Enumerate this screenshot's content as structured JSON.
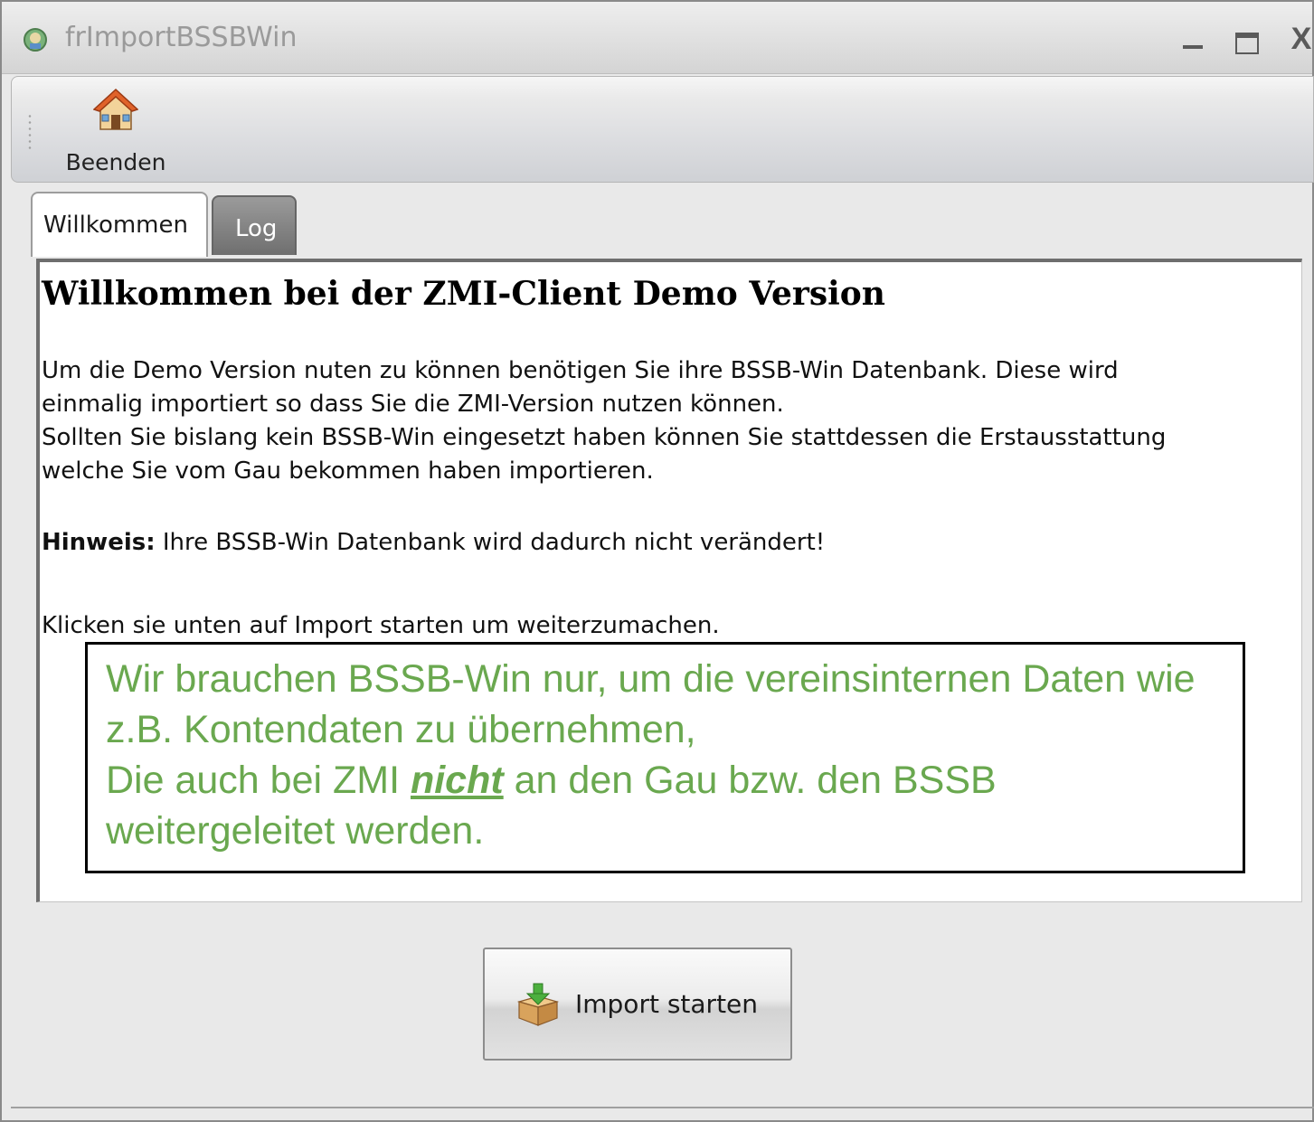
{
  "window": {
    "title": "frImportBSSBWin",
    "controls": {
      "minimize": "minimize",
      "maximize": "maximize",
      "close": "X"
    }
  },
  "toolbar": {
    "beenden_label": "Beenden",
    "beenden_icon": "home-icon"
  },
  "tabs": [
    {
      "label": "Willkommen",
      "active": true
    },
    {
      "label": "Log",
      "active": false
    }
  ],
  "content": {
    "heading": "Willkommen bei der ZMI-Client Demo Version",
    "paragraph1_lines": [
      "Um die Demo Version nuten zu können benötigen Sie ihre BSSB-Win Datenbank. Diese wird",
      "einmalig importiert so dass Sie die ZMI-Version nutzen können.",
      "Sollten Sie bislang kein BSSB-Win eingesetzt haben können Sie stattdessen die Erstausstattung",
      "welche Sie vom Gau bekommen haben importieren."
    ],
    "hint_label": "Hinweis:",
    "hint_text": " Ihre BSSB-Win Datenbank wird dadurch nicht verändert!",
    "instruction": "Klicken sie unten auf Import starten um weiterzumachen."
  },
  "callout": {
    "line1": "Wir brauchen BSSB-Win nur, um die vereinsinternen Daten wie",
    "line2": "z.B. Kontendaten zu übernehmen,",
    "line3_before": "Die auch bei ZMI ",
    "line3_emphasis": "nicht",
    "line3_after": " an den Gau bzw. den BSSB",
    "line4": "weitergeleitet werden.",
    "color": "#6aa84f"
  },
  "import_button": {
    "label": "Import starten",
    "icon": "box-download-icon"
  }
}
